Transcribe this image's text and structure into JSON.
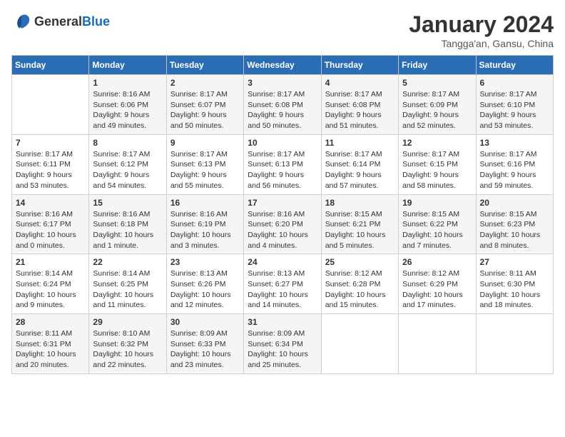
{
  "header": {
    "logo_general": "General",
    "logo_blue": "Blue",
    "month_title": "January 2024",
    "location": "Tangga'an, Gansu, China"
  },
  "days_of_week": [
    "Sunday",
    "Monday",
    "Tuesday",
    "Wednesday",
    "Thursday",
    "Friday",
    "Saturday"
  ],
  "weeks": [
    [
      {
        "day": "",
        "sunrise": "",
        "sunset": "",
        "daylight": ""
      },
      {
        "day": "1",
        "sunrise": "Sunrise: 8:16 AM",
        "sunset": "Sunset: 6:06 PM",
        "daylight": "Daylight: 9 hours and 49 minutes."
      },
      {
        "day": "2",
        "sunrise": "Sunrise: 8:17 AM",
        "sunset": "Sunset: 6:07 PM",
        "daylight": "Daylight: 9 hours and 50 minutes."
      },
      {
        "day": "3",
        "sunrise": "Sunrise: 8:17 AM",
        "sunset": "Sunset: 6:08 PM",
        "daylight": "Daylight: 9 hours and 50 minutes."
      },
      {
        "day": "4",
        "sunrise": "Sunrise: 8:17 AM",
        "sunset": "Sunset: 6:08 PM",
        "daylight": "Daylight: 9 hours and 51 minutes."
      },
      {
        "day": "5",
        "sunrise": "Sunrise: 8:17 AM",
        "sunset": "Sunset: 6:09 PM",
        "daylight": "Daylight: 9 hours and 52 minutes."
      },
      {
        "day": "6",
        "sunrise": "Sunrise: 8:17 AM",
        "sunset": "Sunset: 6:10 PM",
        "daylight": "Daylight: 9 hours and 53 minutes."
      }
    ],
    [
      {
        "day": "7",
        "sunrise": "Sunrise: 8:17 AM",
        "sunset": "Sunset: 6:11 PM",
        "daylight": "Daylight: 9 hours and 53 minutes."
      },
      {
        "day": "8",
        "sunrise": "Sunrise: 8:17 AM",
        "sunset": "Sunset: 6:12 PM",
        "daylight": "Daylight: 9 hours and 54 minutes."
      },
      {
        "day": "9",
        "sunrise": "Sunrise: 8:17 AM",
        "sunset": "Sunset: 6:13 PM",
        "daylight": "Daylight: 9 hours and 55 minutes."
      },
      {
        "day": "10",
        "sunrise": "Sunrise: 8:17 AM",
        "sunset": "Sunset: 6:13 PM",
        "daylight": "Daylight: 9 hours and 56 minutes."
      },
      {
        "day": "11",
        "sunrise": "Sunrise: 8:17 AM",
        "sunset": "Sunset: 6:14 PM",
        "daylight": "Daylight: 9 hours and 57 minutes."
      },
      {
        "day": "12",
        "sunrise": "Sunrise: 8:17 AM",
        "sunset": "Sunset: 6:15 PM",
        "daylight": "Daylight: 9 hours and 58 minutes."
      },
      {
        "day": "13",
        "sunrise": "Sunrise: 8:17 AM",
        "sunset": "Sunset: 6:16 PM",
        "daylight": "Daylight: 9 hours and 59 minutes."
      }
    ],
    [
      {
        "day": "14",
        "sunrise": "Sunrise: 8:16 AM",
        "sunset": "Sunset: 6:17 PM",
        "daylight": "Daylight: 10 hours and 0 minutes."
      },
      {
        "day": "15",
        "sunrise": "Sunrise: 8:16 AM",
        "sunset": "Sunset: 6:18 PM",
        "daylight": "Daylight: 10 hours and 1 minute."
      },
      {
        "day": "16",
        "sunrise": "Sunrise: 8:16 AM",
        "sunset": "Sunset: 6:19 PM",
        "daylight": "Daylight: 10 hours and 3 minutes."
      },
      {
        "day": "17",
        "sunrise": "Sunrise: 8:16 AM",
        "sunset": "Sunset: 6:20 PM",
        "daylight": "Daylight: 10 hours and 4 minutes."
      },
      {
        "day": "18",
        "sunrise": "Sunrise: 8:15 AM",
        "sunset": "Sunset: 6:21 PM",
        "daylight": "Daylight: 10 hours and 5 minutes."
      },
      {
        "day": "19",
        "sunrise": "Sunrise: 8:15 AM",
        "sunset": "Sunset: 6:22 PM",
        "daylight": "Daylight: 10 hours and 7 minutes."
      },
      {
        "day": "20",
        "sunrise": "Sunrise: 8:15 AM",
        "sunset": "Sunset: 6:23 PM",
        "daylight": "Daylight: 10 hours and 8 minutes."
      }
    ],
    [
      {
        "day": "21",
        "sunrise": "Sunrise: 8:14 AM",
        "sunset": "Sunset: 6:24 PM",
        "daylight": "Daylight: 10 hours and 9 minutes."
      },
      {
        "day": "22",
        "sunrise": "Sunrise: 8:14 AM",
        "sunset": "Sunset: 6:25 PM",
        "daylight": "Daylight: 10 hours and 11 minutes."
      },
      {
        "day": "23",
        "sunrise": "Sunrise: 8:13 AM",
        "sunset": "Sunset: 6:26 PM",
        "daylight": "Daylight: 10 hours and 12 minutes."
      },
      {
        "day": "24",
        "sunrise": "Sunrise: 8:13 AM",
        "sunset": "Sunset: 6:27 PM",
        "daylight": "Daylight: 10 hours and 14 minutes."
      },
      {
        "day": "25",
        "sunrise": "Sunrise: 8:12 AM",
        "sunset": "Sunset: 6:28 PM",
        "daylight": "Daylight: 10 hours and 15 minutes."
      },
      {
        "day": "26",
        "sunrise": "Sunrise: 8:12 AM",
        "sunset": "Sunset: 6:29 PM",
        "daylight": "Daylight: 10 hours and 17 minutes."
      },
      {
        "day": "27",
        "sunrise": "Sunrise: 8:11 AM",
        "sunset": "Sunset: 6:30 PM",
        "daylight": "Daylight: 10 hours and 18 minutes."
      }
    ],
    [
      {
        "day": "28",
        "sunrise": "Sunrise: 8:11 AM",
        "sunset": "Sunset: 6:31 PM",
        "daylight": "Daylight: 10 hours and 20 minutes."
      },
      {
        "day": "29",
        "sunrise": "Sunrise: 8:10 AM",
        "sunset": "Sunset: 6:32 PM",
        "daylight": "Daylight: 10 hours and 22 minutes."
      },
      {
        "day": "30",
        "sunrise": "Sunrise: 8:09 AM",
        "sunset": "Sunset: 6:33 PM",
        "daylight": "Daylight: 10 hours and 23 minutes."
      },
      {
        "day": "31",
        "sunrise": "Sunrise: 8:09 AM",
        "sunset": "Sunset: 6:34 PM",
        "daylight": "Daylight: 10 hours and 25 minutes."
      },
      {
        "day": "",
        "sunrise": "",
        "sunset": "",
        "daylight": ""
      },
      {
        "day": "",
        "sunrise": "",
        "sunset": "",
        "daylight": ""
      },
      {
        "day": "",
        "sunrise": "",
        "sunset": "",
        "daylight": ""
      }
    ]
  ]
}
